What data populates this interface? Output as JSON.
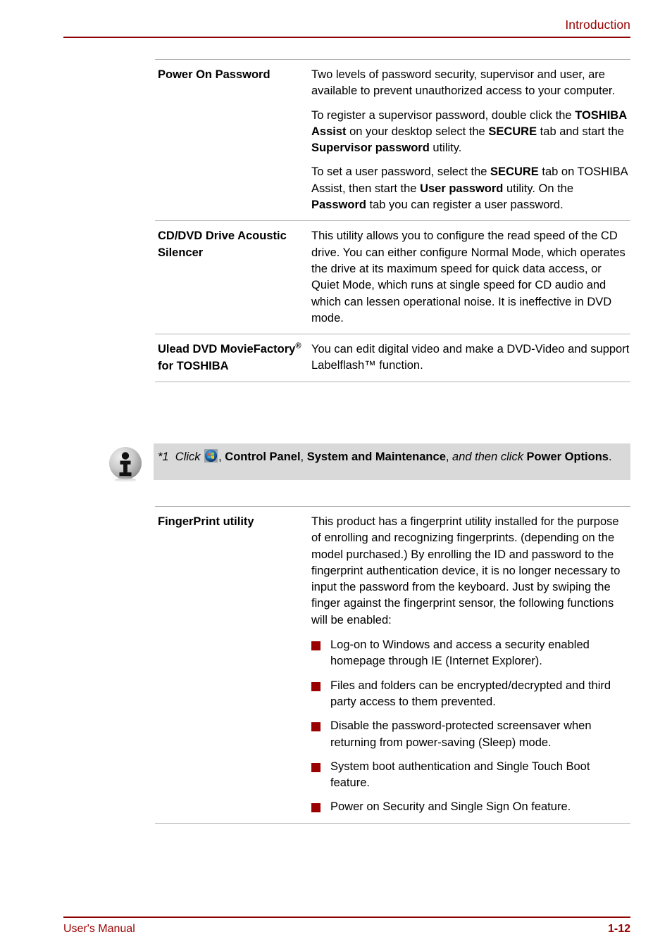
{
  "header": {
    "title": "Introduction"
  },
  "table": {
    "rows": [
      {
        "label": "Power On Password",
        "paragraphs": [
          {
            "runs": [
              {
                "t": "Two levels of password security, supervisor and user, are available to prevent unauthorized access to your computer.",
                "s": "normal"
              }
            ]
          },
          {
            "runs": [
              {
                "t": "To register a supervisor password, double click the ",
                "s": "normal"
              },
              {
                "t": "TOSHIBA Assist",
                "s": "bold"
              },
              {
                "t": " on your desktop select the ",
                "s": "normal"
              },
              {
                "t": "SECURE",
                "s": "bold"
              },
              {
                "t": " tab and start the ",
                "s": "normal"
              },
              {
                "t": "Supervisor password",
                "s": "bold"
              },
              {
                "t": " utility.",
                "s": "normal"
              }
            ]
          },
          {
            "runs": [
              {
                "t": "To set a user password, select the ",
                "s": "normal"
              },
              {
                "t": "SECURE",
                "s": "bold"
              },
              {
                "t": " tab on TOSHIBA Assist, then start the ",
                "s": "normal"
              },
              {
                "t": "User password",
                "s": "bold"
              },
              {
                "t": " utility. On the ",
                "s": "normal"
              },
              {
                "t": "Password",
                "s": "bold"
              },
              {
                "t": " tab you can register a user password.",
                "s": "normal"
              }
            ]
          }
        ]
      },
      {
        "label": "CD/DVD Drive Acoustic Silencer",
        "paragraphs": [
          {
            "runs": [
              {
                "t": "This utility allows you to configure the read speed of the CD drive. You can either configure Normal Mode, which operates the drive at its maximum speed for quick data access, or Quiet Mode, which runs at single speed for CD audio and which can lessen operational noise. It is ineffective in DVD mode.",
                "s": "normal"
              }
            ]
          }
        ]
      },
      {
        "label": "Ulead DVD MovieFactory® for TOSHIBA",
        "label_runs": [
          {
            "t": "Ulead DVD MovieFactory",
            "s": "bold"
          },
          {
            "t": "®",
            "s": "sup-bold"
          },
          {
            "t": " for TOSHIBA",
            "s": "bold"
          }
        ],
        "paragraphs": [
          {
            "runs": [
              {
                "t": "You can edit digital video and make a DVD-Video and support Labelflash™ function.",
                "s": "normal"
              }
            ]
          }
        ]
      }
    ]
  },
  "note": {
    "icon_name": "info-icon",
    "inline_icon_name": "windows-start-orb-icon",
    "runs_before_icon": [
      {
        "t": "*1",
        "s": "italic"
      },
      {
        "t": "  Click ",
        "s": "italic"
      }
    ],
    "runs_after_icon": [
      {
        "t": ", ",
        "s": "normal"
      },
      {
        "t": "Control Panel",
        "s": "bold"
      },
      {
        "t": ", ",
        "s": "normal"
      },
      {
        "t": "System and Maintenance",
        "s": "bold"
      },
      {
        "t": ", ",
        "s": "normal"
      },
      {
        "t": "and then click",
        "s": "italic"
      },
      {
        "t": " ",
        "s": "normal"
      },
      {
        "t": "Power Options",
        "s": "bold"
      },
      {
        "t": ".",
        "s": "normal"
      }
    ]
  },
  "fingerprint": {
    "label": "FingerPrint utility",
    "intro": "This product has a fingerprint utility installed for the purpose of enrolling and recognizing fingerprints. (depending on the model purchased.) By enrolling the ID and password to the fingerprint authentication device, it is no longer necessary to input the password from the keyboard. Just by swiping the finger against the fingerprint sensor, the following functions will be enabled:",
    "bullets": [
      "Log-on to Windows and access a security enabled homepage through IE (Internet Explorer).",
      "Files and folders can be encrypted/decrypted and third party access to them prevented.",
      "Disable the password-protected screensaver when returning from power-saving (Sleep) mode.",
      "System boot authentication and Single Touch Boot feature.",
      "Power on Security and Single Sign On feature."
    ]
  },
  "footer": {
    "left": "User's Manual",
    "right": "1-12"
  },
  "colors": {
    "accent_red": "#8e0000",
    "header_text_red": "#9a0000",
    "bullet_red": "#9b0000",
    "note_background": "#d9d9d9",
    "rule_gray": "#b3b3b3"
  }
}
